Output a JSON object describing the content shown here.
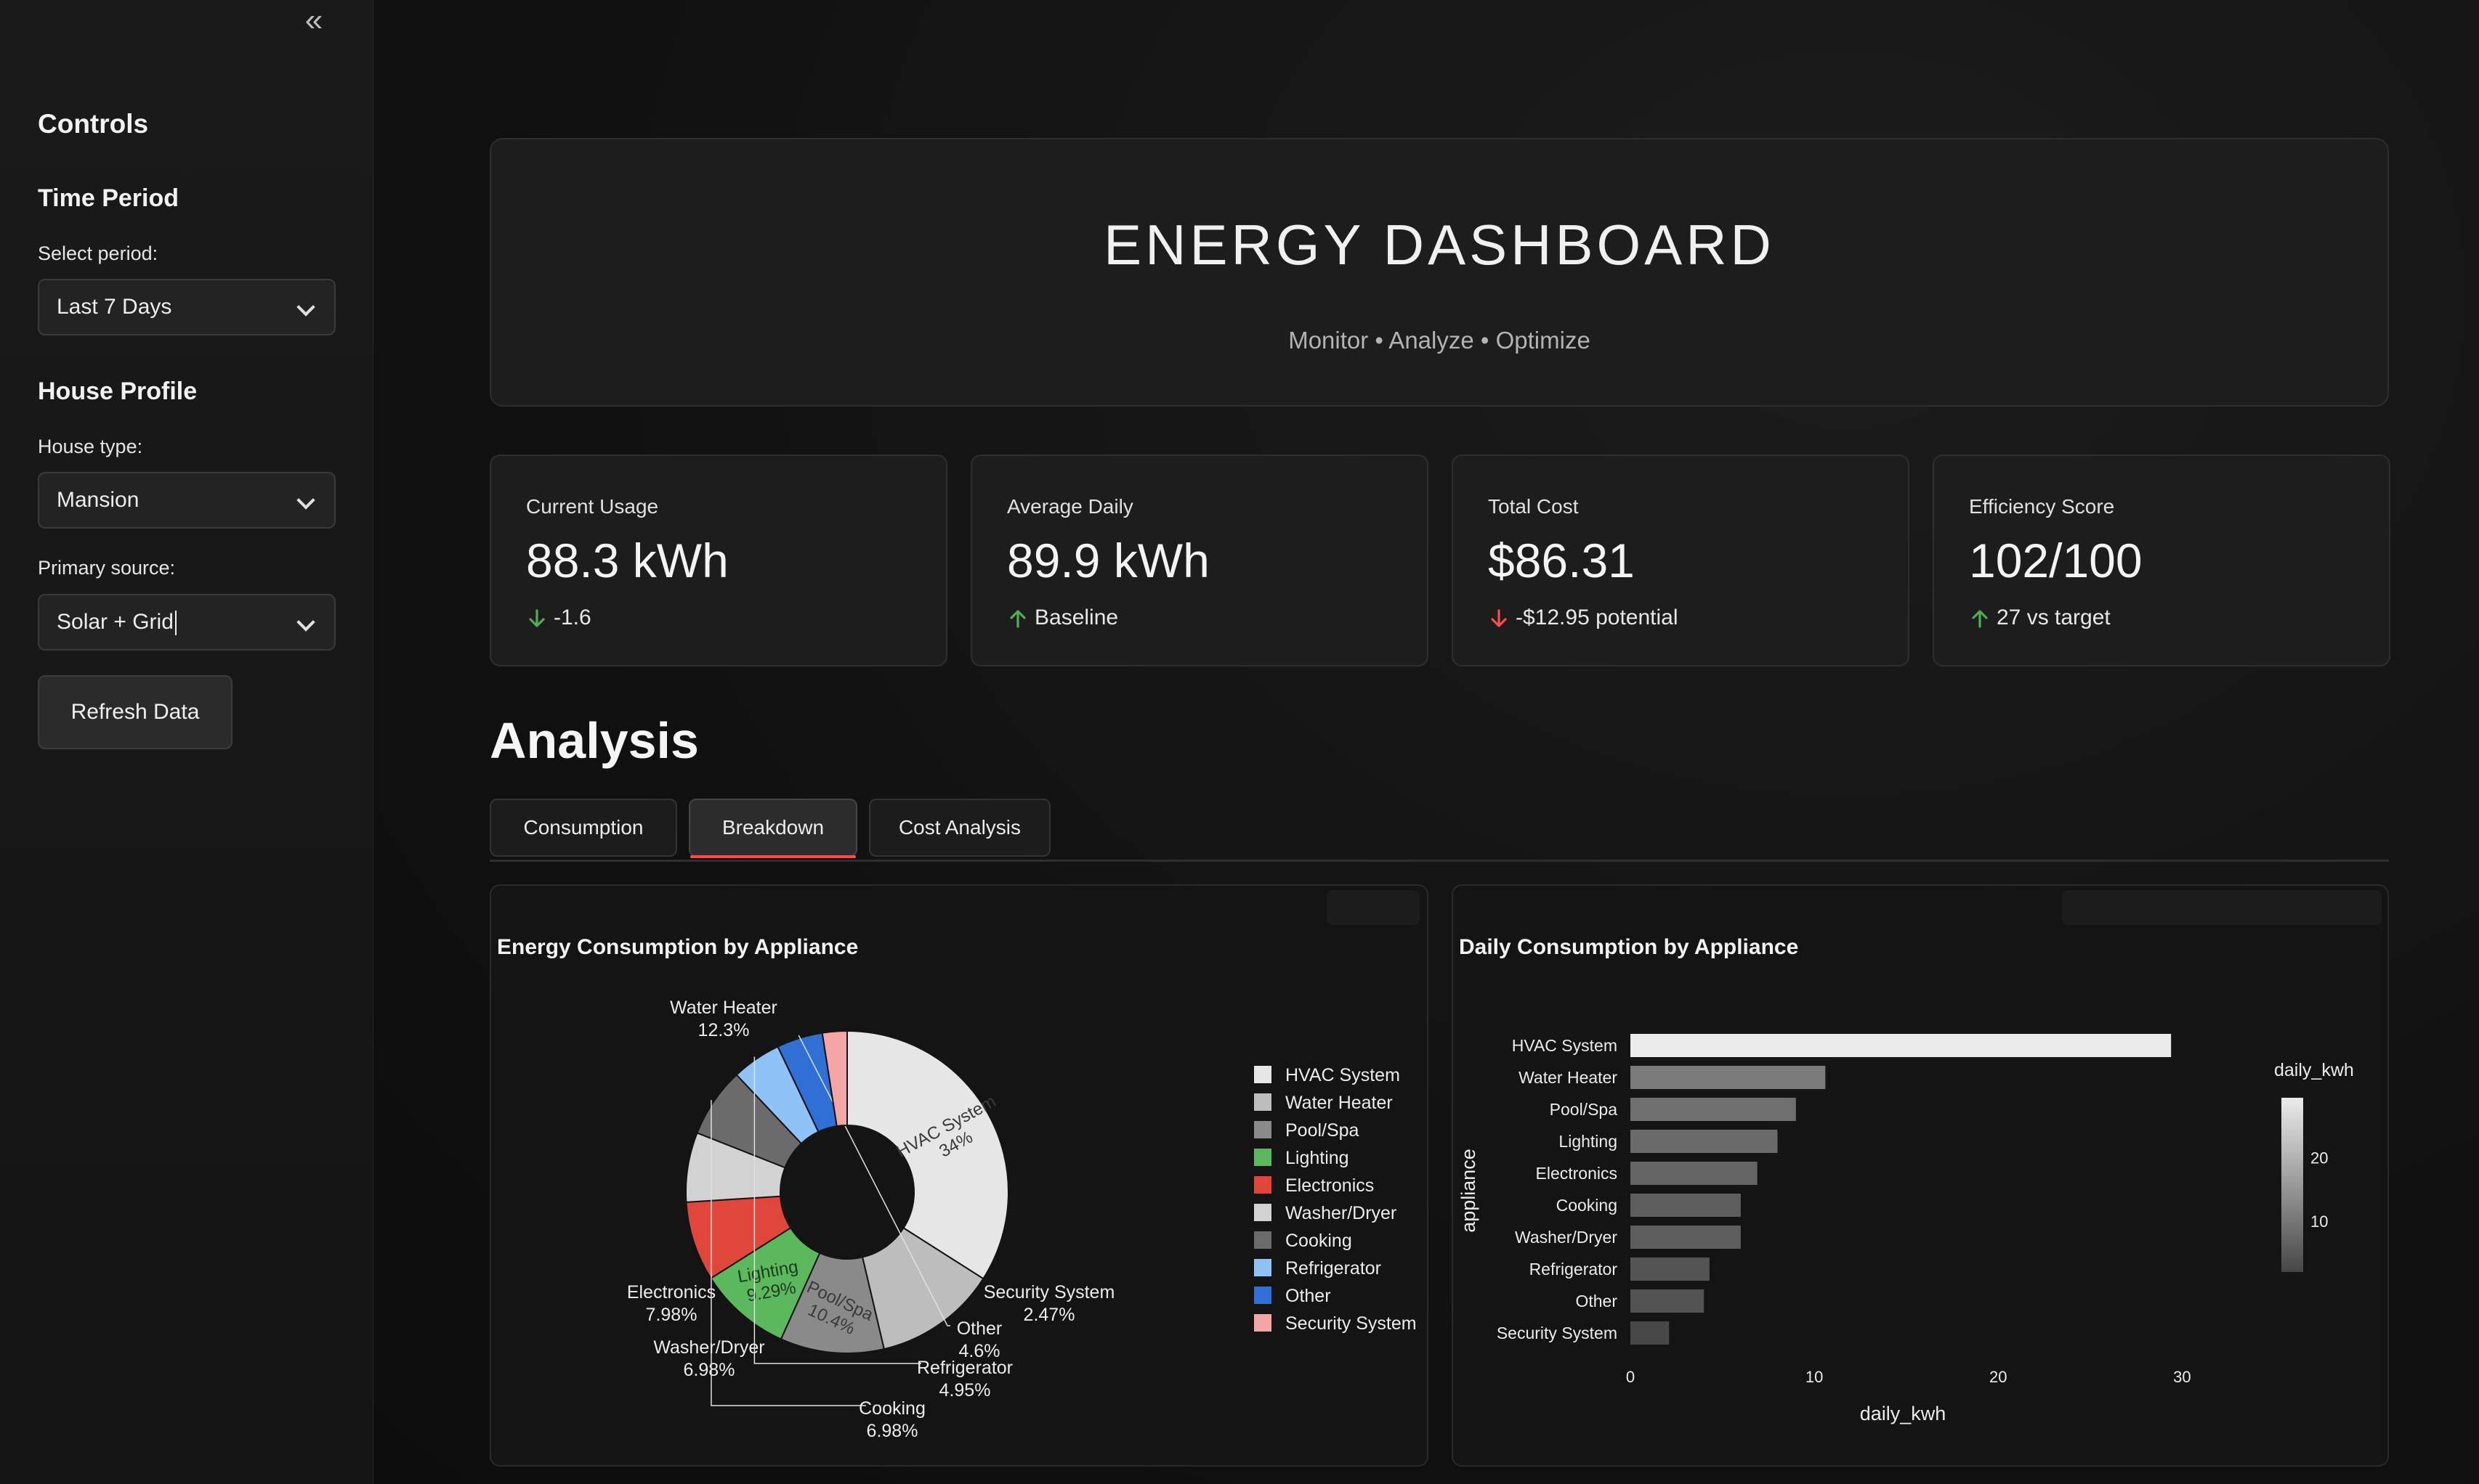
{
  "sidebar": {
    "collapse_glyph": "«",
    "title": "Controls",
    "time_period": {
      "heading": "Time Period",
      "select_label": "Select period:",
      "select_value": "Last 7 Days"
    },
    "house_profile": {
      "heading": "House Profile",
      "house_type_label": "House type:",
      "house_type_value": "Mansion",
      "primary_source_label": "Primary source:",
      "primary_source_value": "Solar + Grid"
    },
    "refresh_label": "Refresh Data"
  },
  "header": {
    "title": "ENERGY DASHBOARD",
    "subtitle": "Monitor • Analyze • Optimize"
  },
  "metrics": [
    {
      "label": "Current Usage",
      "value": "88.3 kWh",
      "delta": "-1.6",
      "direction": "down",
      "color": "#4caf50"
    },
    {
      "label": "Average Daily",
      "value": "89.9 kWh",
      "delta": "Baseline",
      "direction": "up",
      "color": "#4caf50"
    },
    {
      "label": "Total Cost",
      "value": "$86.31",
      "delta": "-$12.95 potential",
      "direction": "down",
      "color": "#ff4b4b"
    },
    {
      "label": "Efficiency Score",
      "value": "102/100",
      "delta": "27 vs target",
      "direction": "up",
      "color": "#4caf50"
    }
  ],
  "analysis": {
    "title": "Analysis",
    "tabs": [
      "Consumption",
      "Breakdown",
      "Cost Analysis"
    ],
    "active_tab": "Breakdown",
    "accent": "#ff4b4b"
  },
  "chart_data": [
    {
      "type": "pie",
      "title": "Energy Consumption by Appliance",
      "hole": true,
      "legend_position": "right",
      "slices": [
        {
          "label": "HVAC System",
          "value": 34,
          "display": "34%",
          "color": "#e6e6e6"
        },
        {
          "label": "Water Heater",
          "value": 12.3,
          "display": "12.3%",
          "color": "#bdbdbd"
        },
        {
          "label": "Pool/Spa",
          "value": 10.4,
          "display": "10.4%",
          "color": "#8a8a8a"
        },
        {
          "label": "Lighting",
          "value": 9.29,
          "display": "9.29%",
          "color": "#5cb85c"
        },
        {
          "label": "Electronics",
          "value": 7.98,
          "display": "7.98%",
          "color": "#e0473a"
        },
        {
          "label": "Washer/Dryer",
          "value": 6.98,
          "display": "6.98%",
          "color": "#d2d2d2"
        },
        {
          "label": "Cooking",
          "value": 6.98,
          "display": "6.98%",
          "color": "#6b6b6b"
        },
        {
          "label": "Refrigerator",
          "value": 4.95,
          "display": "4.95%",
          "color": "#8fc3f7"
        },
        {
          "label": "Other",
          "value": 4.6,
          "display": "4.6%",
          "color": "#2f6fd6"
        },
        {
          "label": "Security System",
          "value": 2.47,
          "display": "2.47%",
          "color": "#f4a6a6"
        }
      ]
    },
    {
      "type": "bar",
      "orientation": "horizontal",
      "title": "Daily Consumption by Appliance",
      "xlabel": "daily_kwh",
      "ylabel": "appliance",
      "xlim": [
        0,
        32
      ],
      "xticks": [
        0,
        10,
        20,
        30
      ],
      "categories": [
        "HVAC System",
        "Water Heater",
        "Pool/Spa",
        "Lighting",
        "Electronics",
        "Cooking",
        "Washer/Dryer",
        "Refrigerator",
        "Other",
        "Security System"
      ],
      "values": [
        29.4,
        10.6,
        9.0,
        8.0,
        6.9,
        6.0,
        6.0,
        4.3,
        4.0,
        2.1
      ],
      "colorbar": {
        "title": "daily_kwh",
        "ticks": [
          10,
          20
        ],
        "range": [
          2,
          29.4
        ]
      }
    }
  ]
}
